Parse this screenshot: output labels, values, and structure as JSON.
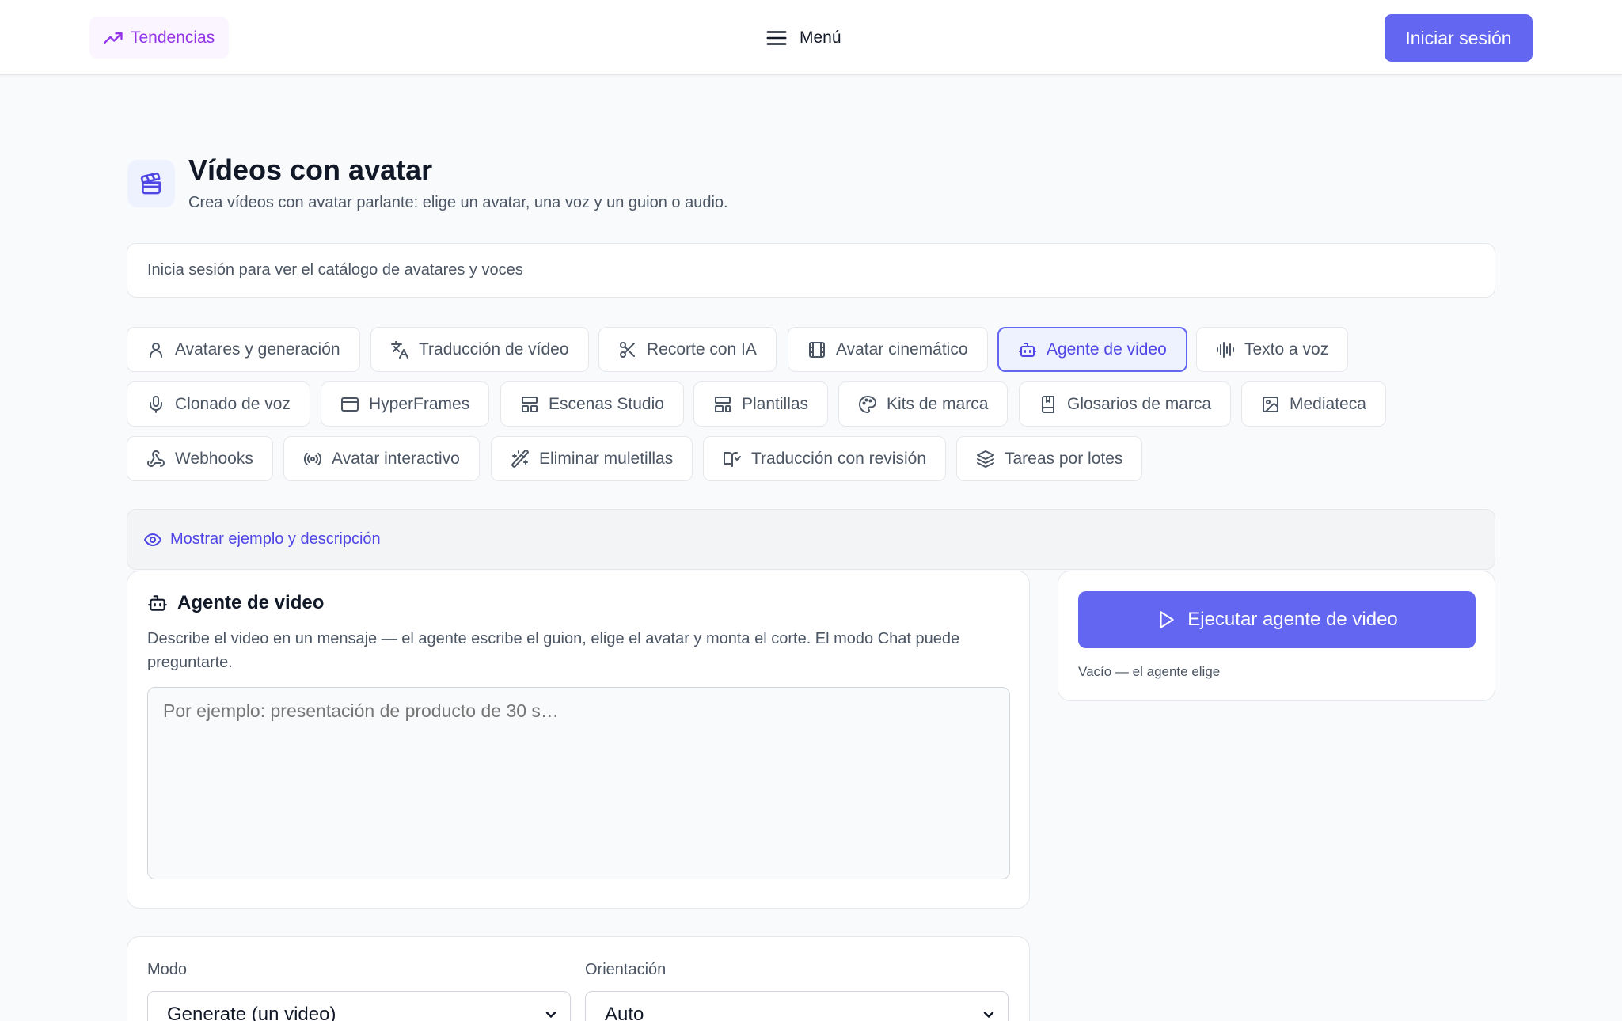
{
  "header": {
    "trending_label": "Tendencias",
    "menu_label": "Menú",
    "login_label": "Iniciar sesión"
  },
  "page": {
    "title": "Vídeos con avatar",
    "subtitle": "Crea vídeos con avatar parlante: elige un avatar, una voz y un guion o audio.",
    "notice": "Inicia sesión para ver el catálogo de avatares y voces"
  },
  "tabs": [
    {
      "label": "Avatares y generación",
      "icon": "user-icon"
    },
    {
      "label": "Traducción de vídeo",
      "icon": "translate-icon"
    },
    {
      "label": "Recorte con IA",
      "icon": "scissors-icon"
    },
    {
      "label": "Avatar cinemático",
      "icon": "film-icon"
    },
    {
      "label": "Agente de video",
      "icon": "bot-icon",
      "active": true
    },
    {
      "label": "Texto a voz",
      "icon": "audio-wave-icon"
    },
    {
      "label": "Clonado de voz",
      "icon": "microphone-icon"
    },
    {
      "label": "HyperFrames",
      "icon": "browser-window-icon"
    },
    {
      "label": "Escenas Studio",
      "icon": "layout-icon"
    },
    {
      "label": "Plantillas",
      "icon": "template-icon"
    },
    {
      "label": "Kits de marca",
      "icon": "palette-icon"
    },
    {
      "label": "Glosarios de marca",
      "icon": "book-icon"
    },
    {
      "label": "Mediateca",
      "icon": "image-icon"
    },
    {
      "label": "Webhooks",
      "icon": "webhook-icon"
    },
    {
      "label": "Avatar interactivo",
      "icon": "broadcast-icon"
    },
    {
      "label": "Eliminar muletillas",
      "icon": "magic-wand-icon"
    },
    {
      "label": "Traducción con revisión",
      "icon": "book-check-icon"
    },
    {
      "label": "Tareas por lotes",
      "icon": "layers-icon"
    }
  ],
  "example_toggle": "Mostrar ejemplo y descripción",
  "agent": {
    "title": "Agente de video",
    "description": "Describe el video en un mensaje — el agente escribe el guion, elige el avatar y monta el corte. El modo Chat puede preguntarte.",
    "prompt_placeholder": "Por ejemplo: presentación de producto de 30 s…"
  },
  "run": {
    "button_label": "Ejecutar agente de video",
    "note": "Vacío — el agente elige"
  },
  "settings": {
    "mode_label": "Modo",
    "mode_value": "Generate (un video)",
    "orientation_label": "Orientación",
    "orientation_value": "Auto"
  },
  "colors": {
    "accent": "#6366f1",
    "trending": "#9333ea"
  }
}
